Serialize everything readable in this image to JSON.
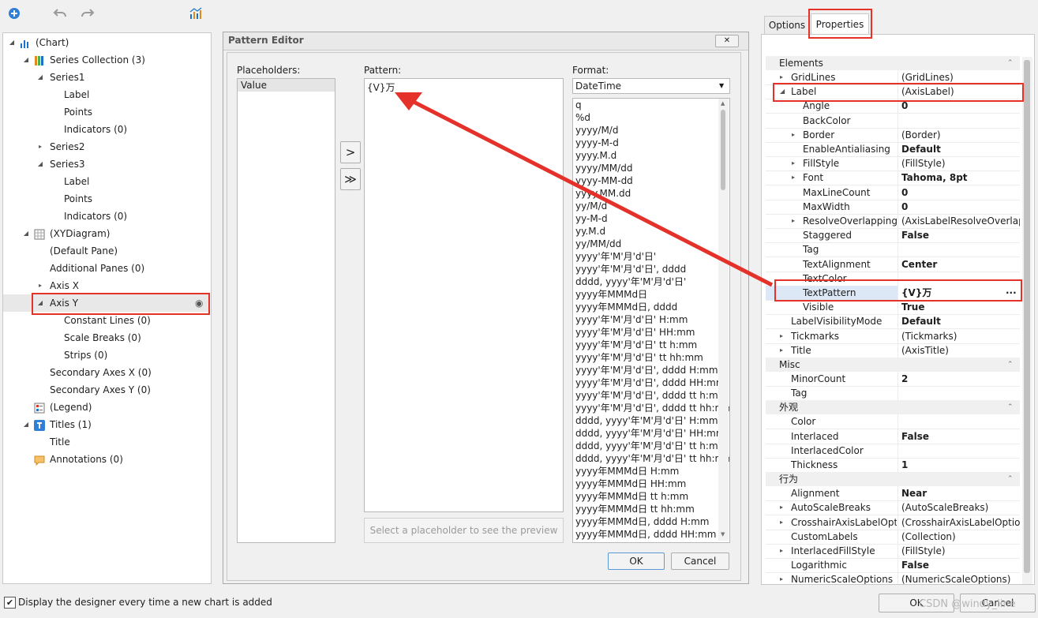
{
  "toolbar": {
    "icons": [
      "add-icon",
      "undo-icon",
      "redo-icon",
      "chart-wizard-icon"
    ]
  },
  "tree": {
    "items": [
      {
        "label": "(Chart)",
        "level": 0,
        "expander": "expanded",
        "icon": "chart-icon"
      },
      {
        "label": "Series Collection (3)",
        "level": 1,
        "expander": "expanded",
        "icon": "series-collection-icon"
      },
      {
        "label": "Series1",
        "level": 2,
        "expander": "expanded",
        "icon": ""
      },
      {
        "label": "Label",
        "level": 3,
        "expander": "",
        "icon": ""
      },
      {
        "label": "Points",
        "level": 3,
        "expander": "",
        "icon": ""
      },
      {
        "label": "Indicators (0)",
        "level": 3,
        "expander": "",
        "icon": ""
      },
      {
        "label": "Series2",
        "level": 2,
        "expander": "collapsed",
        "icon": ""
      },
      {
        "label": "Series3",
        "level": 2,
        "expander": "expanded",
        "icon": ""
      },
      {
        "label": "Label",
        "level": 3,
        "expander": "",
        "icon": ""
      },
      {
        "label": "Points",
        "level": 3,
        "expander": "",
        "icon": ""
      },
      {
        "label": "Indicators (0)",
        "level": 3,
        "expander": "",
        "icon": ""
      },
      {
        "label": "(XYDiagram)",
        "level": 1,
        "expander": "expanded",
        "icon": "diagram-icon"
      },
      {
        "label": "(Default Pane)",
        "level": 2,
        "expander": "",
        "icon": ""
      },
      {
        "label": "Additional Panes (0)",
        "level": 2,
        "expander": "",
        "icon": ""
      },
      {
        "label": "Axis X",
        "level": 2,
        "expander": "collapsed",
        "icon": ""
      },
      {
        "label": "Axis Y",
        "level": 2,
        "expander": "expanded",
        "icon": "",
        "selected": true
      },
      {
        "label": "Constant Lines (0)",
        "level": 3,
        "expander": "",
        "icon": ""
      },
      {
        "label": "Scale Breaks (0)",
        "level": 3,
        "expander": "",
        "icon": ""
      },
      {
        "label": "Strips (0)",
        "level": 3,
        "expander": "",
        "icon": ""
      },
      {
        "label": "Secondary Axes X (0)",
        "level": 2,
        "expander": "",
        "icon": ""
      },
      {
        "label": "Secondary Axes Y (0)",
        "level": 2,
        "expander": "",
        "icon": ""
      },
      {
        "label": "(Legend)",
        "level": 1,
        "expander": "",
        "icon": "legend-icon"
      },
      {
        "label": "Titles (1)",
        "level": 1,
        "expander": "expanded",
        "icon": "titles-icon"
      },
      {
        "label": "Title",
        "level": 2,
        "expander": "",
        "icon": ""
      },
      {
        "label": "Annotations (0)",
        "level": 1,
        "expander": "",
        "icon": "annotations-icon"
      }
    ]
  },
  "dialog": {
    "title": "Pattern Editor",
    "placeholders_label": "Placeholders:",
    "placeholders": [
      "Value"
    ],
    "pattern_label": "Pattern:",
    "pattern_value": "{V}万",
    "format_label": "Format:",
    "format_selected": "DateTime",
    "formats": [
      "q",
      "%d",
      "yyyy/M/d",
      "yyyy-M-d",
      "yyyy.M.d",
      "yyyy/MM/dd",
      "yyyy-MM-dd",
      "yyyy.MM.dd",
      "yy/M/d",
      "yy-M-d",
      "yy.M.d",
      "yy/MM/dd",
      "yyyy'年'M'月'd'日'",
      "yyyy'年'M'月'd'日', dddd",
      "dddd, yyyy'年'M'月'd'日'",
      "yyyy年MMMd日",
      "yyyy年MMMd日, dddd",
      "yyyy'年'M'月'd'日' H:mm",
      "yyyy'年'M'月'd'日' HH:mm",
      "yyyy'年'M'月'd'日' tt h:mm",
      "yyyy'年'M'月'd'日' tt hh:mm",
      "yyyy'年'M'月'd'日', dddd H:mm",
      "yyyy'年'M'月'd'日', dddd HH:mm",
      "yyyy'年'M'月'd'日', dddd tt h:mm",
      "yyyy'年'M'月'd'日', dddd tt hh:mm",
      "dddd, yyyy'年'M'月'd'日' H:mm",
      "dddd, yyyy'年'M'月'd'日' HH:mm",
      "dddd, yyyy'年'M'月'd'日' tt h:mm",
      "dddd, yyyy'年'M'月'd'日' tt hh:mm",
      "yyyy年MMMd日 H:mm",
      "yyyy年MMMd日 HH:mm",
      "yyyy年MMMd日 tt h:mm",
      "yyyy年MMMd日 tt hh:mm",
      "yyyy年MMMd日, dddd H:mm",
      "yyyy年MMMd日, dddd HH:mm"
    ],
    "preview_text": "Select a placeholder to see the preview",
    "insert_label": ">",
    "insert_all_label": "≫",
    "ok_label": "OK",
    "cancel_label": "Cancel",
    "close_label": "✕"
  },
  "tabs": {
    "options": "Options",
    "properties": "Properties"
  },
  "properties": {
    "rows": [
      {
        "type": "cat",
        "name": "Elements"
      },
      {
        "name": "GridLines",
        "value": "(GridLines)",
        "indent": 1,
        "expander": "collapsed"
      },
      {
        "name": "Label",
        "value": "(AxisLabel)",
        "indent": 1,
        "expander": "expanded"
      },
      {
        "name": "Angle",
        "value": "0",
        "indent": 2,
        "bold": true
      },
      {
        "name": "BackColor",
        "value": "",
        "indent": 2
      },
      {
        "name": "Border",
        "value": "(Border)",
        "indent": 2,
        "expander": "collapsed"
      },
      {
        "name": "EnableAntialiasing",
        "value": "Default",
        "indent": 2,
        "bold": true
      },
      {
        "name": "FillStyle",
        "value": "(FillStyle)",
        "indent": 2,
        "expander": "collapsed"
      },
      {
        "name": "Font",
        "value": "Tahoma, 8pt",
        "indent": 2,
        "expander": "collapsed",
        "bold": true
      },
      {
        "name": "MaxLineCount",
        "value": "0",
        "indent": 2,
        "bold": true
      },
      {
        "name": "MaxWidth",
        "value": "0",
        "indent": 2,
        "bold": true
      },
      {
        "name": "ResolveOverlappingO",
        "value": "(AxisLabelResolveOverlap...",
        "indent": 2,
        "expander": "collapsed"
      },
      {
        "name": "Staggered",
        "value": "False",
        "indent": 2,
        "bold": true
      },
      {
        "name": "Tag",
        "value": "",
        "indent": 2
      },
      {
        "name": "TextAlignment",
        "value": "Center",
        "indent": 2,
        "bold": true
      },
      {
        "name": "TextColor",
        "value": "",
        "indent": 2
      },
      {
        "name": "TextPattern",
        "value": "{V}万",
        "indent": 2,
        "bold": true,
        "selected": true,
        "ellipsis": "···"
      },
      {
        "name": "Visible",
        "value": "True",
        "indent": 2,
        "bold": true
      },
      {
        "name": "LabelVisibilityMode",
        "value": "Default",
        "indent": 1,
        "bold": true
      },
      {
        "name": "Tickmarks",
        "value": "(Tickmarks)",
        "indent": 1,
        "expander": "collapsed"
      },
      {
        "name": "Title",
        "value": "(AxisTitle)",
        "indent": 1,
        "expander": "collapsed"
      },
      {
        "type": "cat",
        "name": "Misc"
      },
      {
        "name": "MinorCount",
        "value": "2",
        "indent": 1,
        "bold": true
      },
      {
        "name": "Tag",
        "value": "",
        "indent": 1
      },
      {
        "type": "cat",
        "name": "外观"
      },
      {
        "name": "Color",
        "value": "",
        "indent": 1
      },
      {
        "name": "Interlaced",
        "value": "False",
        "indent": 1,
        "bold": true
      },
      {
        "name": "InterlacedColor",
        "value": "",
        "indent": 1
      },
      {
        "name": "Thickness",
        "value": "1",
        "indent": 1,
        "bold": true
      },
      {
        "type": "cat",
        "name": "行为"
      },
      {
        "name": "Alignment",
        "value": "Near",
        "indent": 1,
        "bold": true
      },
      {
        "name": "AutoScaleBreaks",
        "value": "(AutoScaleBreaks)",
        "indent": 1,
        "expander": "collapsed"
      },
      {
        "name": "CrosshairAxisLabelOptio",
        "value": "(CrosshairAxisLabelOptions)",
        "indent": 1,
        "expander": "collapsed"
      },
      {
        "name": "CustomLabels",
        "value": "(Collection)",
        "indent": 1
      },
      {
        "name": "InterlacedFillStyle",
        "value": "(FillStyle)",
        "indent": 1,
        "expander": "collapsed"
      },
      {
        "name": "Logarithmic",
        "value": "False",
        "indent": 1,
        "bold": true
      },
      {
        "name": "NumericScaleOptions",
        "value": "(NumericScaleOptions)",
        "indent": 1,
        "expander": "collapsed"
      }
    ]
  },
  "footer": {
    "checkbox_label": "Display the designer every time a new chart is added",
    "checked": true,
    "ok_label": "OK",
    "cancel_label": "Cancel",
    "watermark": "CSDN @windy_line"
  },
  "colors": {
    "highlight": "#e4322b",
    "selection": "#dde8f6",
    "accent": "#1a73c9"
  }
}
